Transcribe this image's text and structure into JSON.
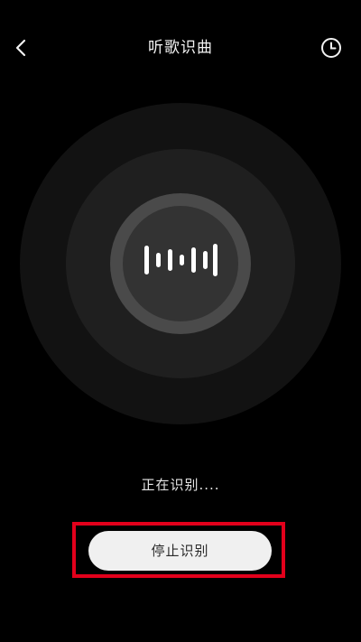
{
  "header": {
    "title": "听歌识曲",
    "back_icon": "chevron-left-icon",
    "history_icon": "clock-icon"
  },
  "status": {
    "text": "正在识别...."
  },
  "actions": {
    "stop_label": "停止识别",
    "highlight_color": "#e3001b"
  },
  "visual": {
    "wave_icon": "audio-wave-icon"
  }
}
